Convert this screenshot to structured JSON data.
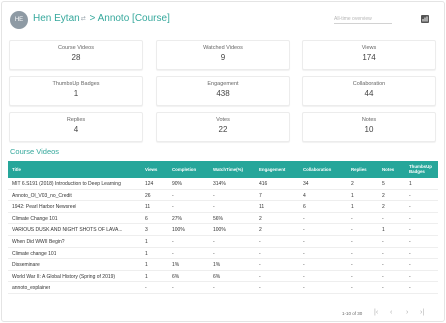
{
  "header": {
    "avatar_initials": "HE",
    "user": "Hen Eytan",
    "course_part": "> Annoto [Course]",
    "search_placeholder": "All-time overview",
    "chart_icon": "bar-chart-icon"
  },
  "stats": [
    {
      "label": "Course Videos",
      "value": "28"
    },
    {
      "label": "Watched Videos",
      "value": "9"
    },
    {
      "label": "Views",
      "value": "174"
    },
    {
      "label": "ThumbsUp Badges",
      "value": "1"
    },
    {
      "label": "Engagement",
      "value": "438"
    },
    {
      "label": "Collaboration",
      "value": "44"
    },
    {
      "label": "Replies",
      "value": "4"
    },
    {
      "label": "Votes",
      "value": "22"
    },
    {
      "label": "Notes",
      "value": "10"
    }
  ],
  "section_title": "Course Videos",
  "table": {
    "columns": [
      "Title",
      "Views",
      "Completion",
      "WatchTime(%)",
      "Engagement",
      "Collaboration",
      "Replies",
      "Notes",
      "ThumbsUp Badges"
    ],
    "thumbs_col_line1": "ThumbsUp",
    "thumbs_col_line2": "Badges",
    "rows": [
      [
        "MIT 6.S191 (2018) Introduction to Deep Learning",
        "124",
        "90%",
        "314%",
        "416",
        "34",
        "2",
        "5",
        "1"
      ],
      [
        "Annoto_Ol_V03_no_Credit",
        "26",
        "-",
        "-",
        "7",
        "4",
        "1",
        "2",
        "-"
      ],
      [
        "1942: Pearl Harbor Newsreel",
        "11",
        "-",
        "-",
        "11",
        "6",
        "1",
        "2",
        "-"
      ],
      [
        "Climate Change 101",
        "6",
        "27%",
        "56%",
        "2",
        "-",
        "-",
        "-",
        "-"
      ],
      [
        "VARIOUS DUSK AND NIGHT SHOTS OF LAVA...",
        "3",
        "100%",
        "100%",
        "2",
        "-",
        "-",
        "1",
        "-"
      ],
      [
        "When Did WWII Begin?",
        "1",
        "-",
        "-",
        "-",
        "-",
        "-",
        "-",
        "-"
      ],
      [
        "Climate change 101",
        "1",
        "-",
        "-",
        "-",
        "-",
        "-",
        "-",
        "-"
      ],
      [
        "Disseminare",
        "1",
        "1%",
        "1%",
        "-",
        "-",
        "-",
        "-",
        "-"
      ],
      [
        "World War II: A Global History (Spring of 2019)",
        "1",
        "6%",
        "6%",
        "-",
        "-",
        "-",
        "-",
        "-"
      ],
      [
        "annoto_explainer",
        "-",
        "-",
        "-",
        "-",
        "-",
        "-",
        "-",
        "-"
      ]
    ]
  },
  "pagination": {
    "range": "1-10 of 30",
    "first": "|‹",
    "prev": "‹",
    "next": "›",
    "last": "›|"
  },
  "colors": {
    "accent": "#26a69a",
    "title": "#35a89c"
  }
}
